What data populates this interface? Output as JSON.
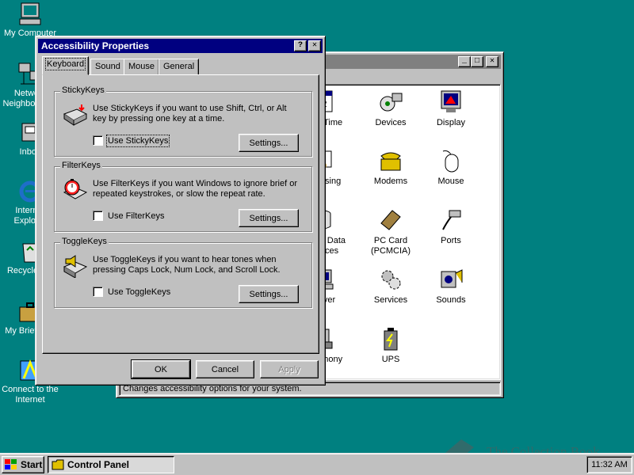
{
  "desktop": {
    "icons": [
      {
        "label": "My Computer"
      },
      {
        "label": "Network Neighborhood"
      },
      {
        "label": "Inbox"
      },
      {
        "label": "Internet Explorer"
      },
      {
        "label": "Recycle Bin"
      },
      {
        "label": "My Briefcase"
      },
      {
        "label": "Connect to the Internet"
      }
    ]
  },
  "control_panel": {
    "window_title": "",
    "status_text": "Changes accessibility options for your system.",
    "icons": [
      {
        "label": "Date/Time"
      },
      {
        "label": "Devices"
      },
      {
        "label": "Display"
      },
      {
        "label": "Licensing"
      },
      {
        "label": "Modems"
      },
      {
        "label": "Mouse"
      },
      {
        "label": "ODBC Data Sources"
      },
      {
        "label": "PC Card (PCMCIA)"
      },
      {
        "label": "Ports"
      },
      {
        "label": "Server"
      },
      {
        "label": "Services"
      },
      {
        "label": "Sounds"
      },
      {
        "label": "Telephony"
      },
      {
        "label": "UPS"
      }
    ]
  },
  "dialog": {
    "title": "Accessibility Properties",
    "help_glyph": "?",
    "close_glyph": "✕",
    "tabs": [
      {
        "label": "Keyboard",
        "active": true
      },
      {
        "label": "Sound"
      },
      {
        "label": "Mouse"
      },
      {
        "label": "General"
      }
    ],
    "groups": {
      "stickykeys": {
        "title": "StickyKeys",
        "description": "Use StickyKeys if you want to use Shift, Ctrl, or Alt key by pressing one key at a time.",
        "checkbox_label": "Use StickyKeys",
        "checked": false,
        "settings_label": "Settings..."
      },
      "filterkeys": {
        "title": "FilterKeys",
        "description": "Use FilterKeys if you want Windows to ignore brief or repeated keystrokes, or slow the repeat rate.",
        "checkbox_label": "Use FilterKeys",
        "checked": false,
        "settings_label": "Settings..."
      },
      "togglekeys": {
        "title": "ToggleKeys",
        "description": "Use ToggleKeys if you want to hear tones when pressing Caps Lock, Num Lock, and Scroll Lock.",
        "checkbox_label": "Use ToggleKeys",
        "checked": false,
        "settings_label": "Settings..."
      }
    },
    "buttons": {
      "ok": "OK",
      "cancel": "Cancel",
      "apply": "Apply"
    }
  },
  "taskbar": {
    "start_label": "Start",
    "task_label": "Control Panel",
    "clock": "11:32 AM"
  },
  "watermark": "The Collection Book",
  "colors": {
    "desktop": "#008080",
    "title_active": "#000080",
    "title_inactive": "#808080",
    "face": "#c0c0c0"
  }
}
